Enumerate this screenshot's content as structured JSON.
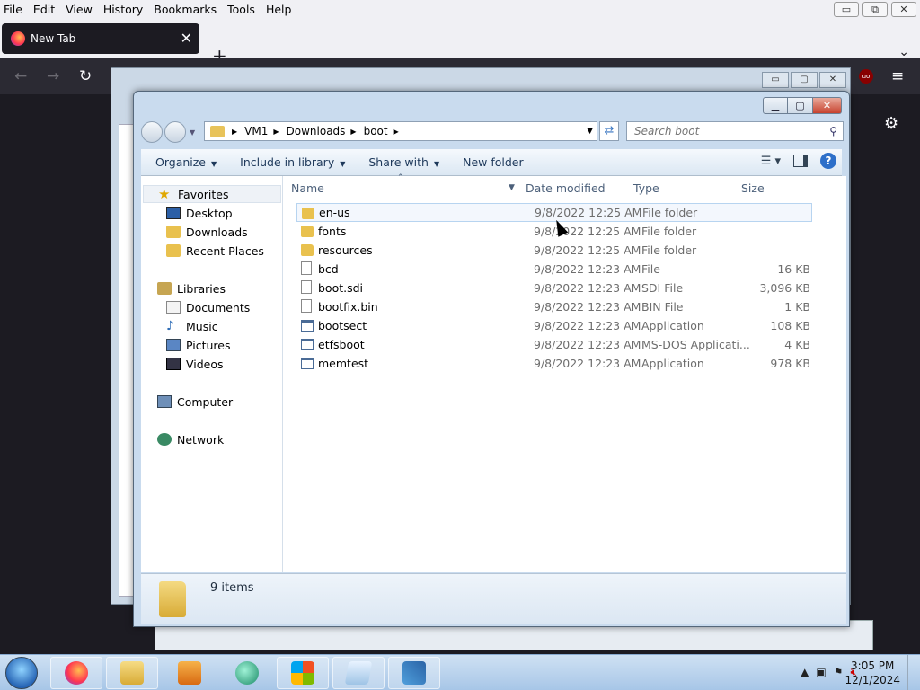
{
  "firefox": {
    "menu": [
      "File",
      "Edit",
      "View",
      "History",
      "Bookmarks",
      "Tools",
      "Help"
    ],
    "tab_title": "New Tab",
    "new_tab_symbol": "+",
    "window_buttons": [
      "▭",
      "⧉",
      "✕"
    ]
  },
  "explorer": {
    "breadcrumbs": [
      "VM1",
      "Downloads",
      "boot"
    ],
    "search_placeholder": "Search boot",
    "toolbar": {
      "organize": "Organize",
      "include_in_library": "Include in library",
      "share_with": "Share with",
      "new_folder": "New folder",
      "help": "?"
    },
    "nav": {
      "favorites": "Favorites",
      "desktop": "Desktop",
      "downloads": "Downloads",
      "recent_places": "Recent Places",
      "libraries": "Libraries",
      "documents": "Documents",
      "music": "Music",
      "pictures": "Pictures",
      "videos": "Videos",
      "computer": "Computer",
      "network": "Network"
    },
    "columns": {
      "name": "Name",
      "date": "Date modified",
      "type": "Type",
      "size": "Size"
    },
    "files": [
      {
        "name": "en-us",
        "date": "9/8/2022 12:25 AM",
        "type": "File folder",
        "size": "",
        "icon": "folder-icon"
      },
      {
        "name": "fonts",
        "date": "9/8/2022 12:25 AM",
        "type": "File folder",
        "size": "",
        "icon": "folder-icon"
      },
      {
        "name": "resources",
        "date": "9/8/2022 12:25 AM",
        "type": "File folder",
        "size": "",
        "icon": "folder-icon"
      },
      {
        "name": "bcd",
        "date": "9/8/2022 12:23 AM",
        "type": "File",
        "size": "16 KB",
        "icon": "file-icon"
      },
      {
        "name": "boot.sdi",
        "date": "9/8/2022 12:23 AM",
        "type": "SDI File",
        "size": "3,096 KB",
        "icon": "file-icon"
      },
      {
        "name": "bootfix.bin",
        "date": "9/8/2022 12:23 AM",
        "type": "BIN File",
        "size": "1 KB",
        "icon": "file-icon"
      },
      {
        "name": "bootsect",
        "date": "9/8/2022 12:23 AM",
        "type": "Application",
        "size": "108 KB",
        "icon": "application-icon"
      },
      {
        "name": "etfsboot",
        "date": "9/8/2022 12:23 AM",
        "type": "MS-DOS Applicati...",
        "size": "4 KB",
        "icon": "application-icon"
      },
      {
        "name": "memtest",
        "date": "9/8/2022 12:23 AM",
        "type": "Application",
        "size": "978 KB",
        "icon": "application-icon"
      }
    ],
    "status": "9 items"
  },
  "taskbar": {
    "time": "3:05 PM",
    "date": "12/1/2024"
  }
}
